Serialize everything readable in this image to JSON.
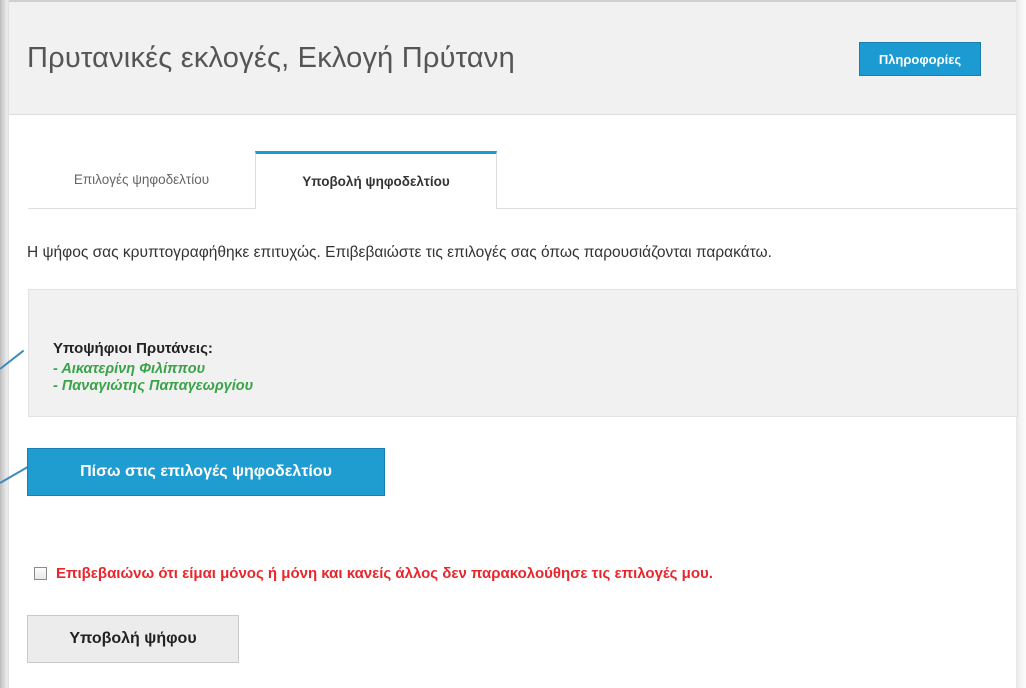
{
  "header": {
    "title": "Πρυτανικές εκλογές, Εκλογή Πρύτανη",
    "info_button_label": "Πληροφορίες"
  },
  "tabs": [
    {
      "label": "Επιλογές ψηφοδελτίου",
      "active": false
    },
    {
      "label": "Υποβολή ψηφοδελτίου",
      "active": true
    }
  ],
  "message": "Η ψήφος σας κρυπτογραφήθηκε επιτυχώς. Επιβεβαιώστε τις επιλογές σας όπως παρουσιάζονται παρακάτω.",
  "summary": {
    "label": "Υποψήφιοι Πρυτάνεις:",
    "selections": [
      "- Αικατερίνη Φιλίππου",
      "- Παναγιώτης Παπαγεωργίου"
    ]
  },
  "back_button_label": "Πίσω στις επιλογές ψηφοδελτίου",
  "confirm": {
    "checked": false,
    "text": "Επιβεβαιώνω ότι είμαι μόνος ή μόνη και κανείς άλλος δεν παρακολούθησε τις επιλογές μου."
  },
  "submit_button_label": "Υποβολή ψήφου",
  "colors": {
    "accent": "#1c9ad2",
    "selection_text": "#3aa34a",
    "warning_text": "#e8262c"
  }
}
